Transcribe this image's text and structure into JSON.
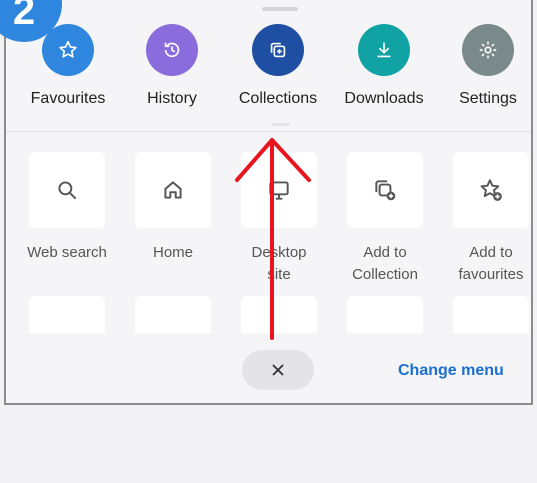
{
  "step_badge": "2",
  "top_menu": [
    {
      "label": "Favourites",
      "icon": "star-icon",
      "color": "#2f86de"
    },
    {
      "label": "History",
      "icon": "history-icon",
      "color": "#8b6cdc"
    },
    {
      "label": "Collections",
      "icon": "collections-icon",
      "color": "#1e4fa2"
    },
    {
      "label": "Downloads",
      "icon": "download-icon",
      "color": "#11a3a3"
    },
    {
      "label": "Settings",
      "icon": "gear-icon",
      "color": "#7a8a8a"
    }
  ],
  "grid_items": [
    {
      "label": "Web search",
      "icon": "search-icon"
    },
    {
      "label": "Home",
      "icon": "home-icon"
    },
    {
      "label": "Desktop\nsite",
      "icon": "desktop-icon"
    },
    {
      "label": "Add to\nCollection",
      "icon": "add-collection-icon"
    },
    {
      "label": "Add to\nfavourites",
      "icon": "add-favourite-icon"
    }
  ],
  "second_row_icons": [
    "row-icon-1",
    "row-icon-2",
    "row-icon-3",
    "row-icon-4",
    "row-icon-5"
  ],
  "footer": {
    "close_icon": "close-icon",
    "change_menu_label": "Change menu",
    "link_color": "#1a6fd0"
  },
  "annotation": {
    "color": "#e8141e",
    "icon": "arrow-up-icon"
  }
}
